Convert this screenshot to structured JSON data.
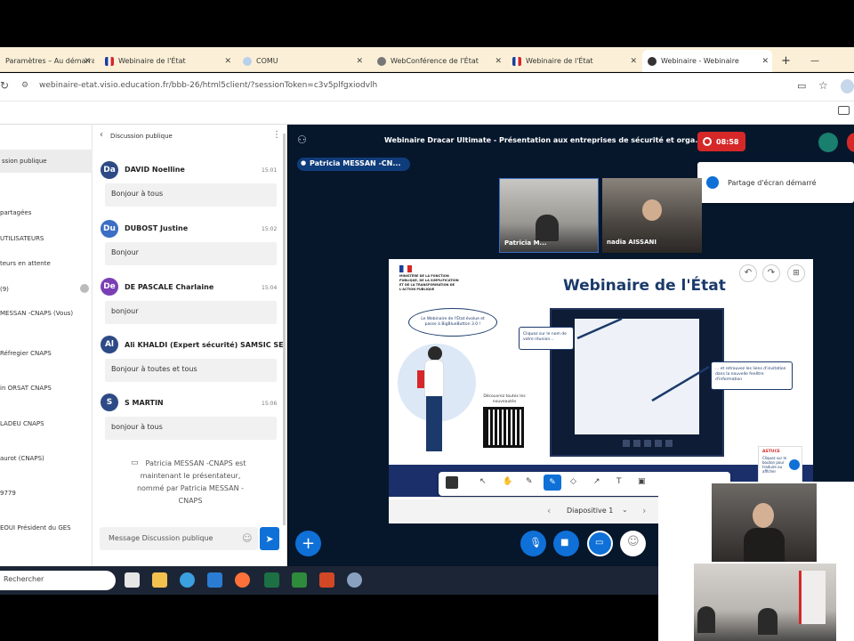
{
  "browser": {
    "tabs": [
      {
        "label": "Paramètres – Au démarrage",
        "active": false
      },
      {
        "label": "Webinaire de l'État",
        "active": false
      },
      {
        "label": "COMU",
        "active": false
      },
      {
        "label": "WebConférence de l'État",
        "active": false
      },
      {
        "label": "Webinaire de l'État",
        "active": false
      },
      {
        "label": "Webinaire - Webinaire",
        "active": true
      }
    ],
    "url": "webinaire-etat.visio.education.fr/bbb-26/html5client/?sessionToken=c3v5plfgxiodvlh"
  },
  "sidebar": {
    "items": [
      "ssion publique",
      "partagées",
      "UTILISATEURS",
      "teurs en attente",
      "(9)",
      "MESSAN -CNAPS (Vous)",
      "Réfregier CNAPS",
      "in ORSAT CNAPS",
      "LADEU CNAPS",
      "aurot (CNAPS)",
      "9779",
      "EOUI Président du GES"
    ]
  },
  "chat": {
    "title": "Discussion publique",
    "messages": [
      {
        "initials": "Da",
        "name": "DAVID Noelline",
        "time": "15:01",
        "text": "Bonjour à tous",
        "color": "#2d4a86"
      },
      {
        "initials": "Du",
        "name": "DUBOST Justine",
        "time": "15:02",
        "text": "Bonjour",
        "color": "#3b6ec4"
      },
      {
        "initials": "De",
        "name": "DE PASCALE Charlaine",
        "time": "15:04",
        "text": "bonjour",
        "color": "#7a3fb5"
      },
      {
        "initials": "Al",
        "name": "Ali KHALDI (Expert sécurité) SAMSIC SE...",
        "time": "",
        "text": "Bonjour à toutes et tous",
        "color": "#2d4a86"
      },
      {
        "initials": "S",
        "name": "S MARTIN",
        "time": "15:06",
        "text": "bonjour à tous",
        "color": "#2d4a86"
      }
    ],
    "system_message": "Patricia MESSAN -CNAPS est maintenant le présentateur, nommé par Patricia MESSAN -CNAPS",
    "input_placeholder": "Message Discussion publique"
  },
  "meeting": {
    "title": "Webinaire Dracar Ultimate - Présentation aux entreprises de sécurité et orga...",
    "recording_time": "08:58",
    "presenter_badge": "Patricia MESSAN -CN...",
    "toast": "Partage d'écran démarré",
    "cameras": [
      {
        "label": "Patricia M..."
      },
      {
        "label": "nadia AISSANI"
      }
    ],
    "slide": {
      "title": "Webinaire de l'État",
      "ministry": "MINISTÈRE DE LA FONCTION PUBLIQUE, DE LA SIMPLIFICATION ET DE LA TRANSFORMATION DE L'ACTION PUBLIQUE",
      "bubble": "Le Webinaire de l'État évolue et passe à BigBlueButton 3.0 !",
      "callout_left": "Cliquez sur le nom de votre réunion...",
      "callout_right": "... et retrouvez les liens d'invitation dans la nouvelle fenêtre d'information",
      "qr_caption": "Découvrez toutes les nouveautés",
      "astuce_label": "ASTUCE",
      "astuce_text": "Cliquez sur le bouton pour traduire ou afficher",
      "page_label": "Diapositive 1"
    }
  },
  "taskbar": {
    "search_placeholder": "Rechercher"
  },
  "colors": {
    "bbb_dark": "#06172c",
    "accent_blue": "#0f70d7",
    "recording_red": "#d62828",
    "slide_title": "#1b3a6b"
  }
}
